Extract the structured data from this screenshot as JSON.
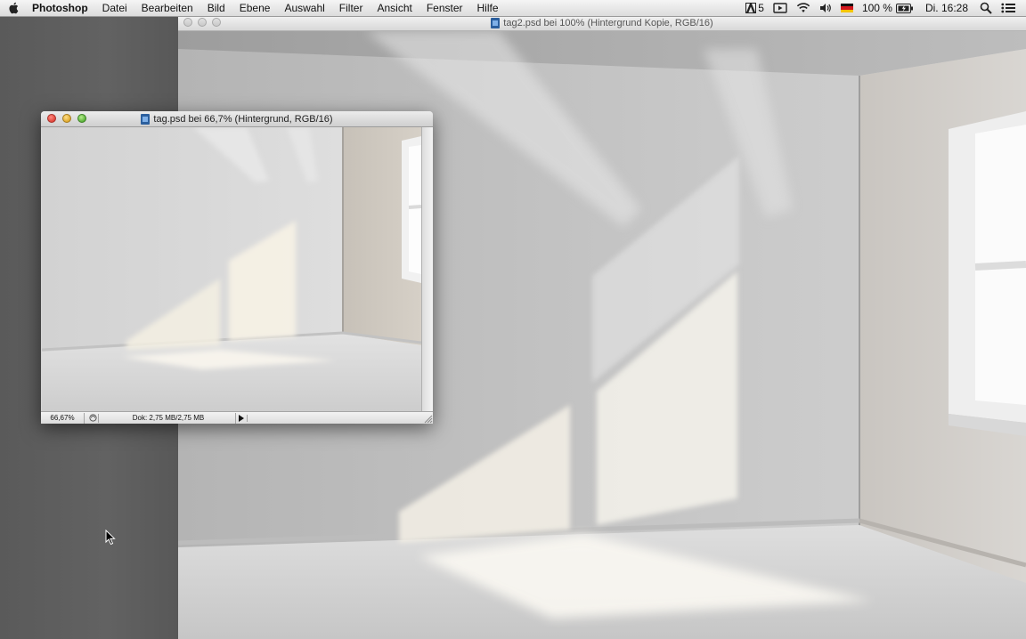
{
  "menubar": {
    "items": [
      "Photoshop",
      "Datei",
      "Bearbeiten",
      "Bild",
      "Ebene",
      "Auswahl",
      "Filter",
      "Ansicht",
      "Fenster",
      "Hilfe"
    ],
    "status": {
      "adobe_count": "5",
      "battery": "100 %",
      "clock": "Di. 16:28"
    }
  },
  "window_main": {
    "title": "tag2.psd bei 100% (Hintergrund Kopie, RGB/16)"
  },
  "window_small": {
    "title": "tag.psd bei 66,7% (Hintergrund, RGB/16)",
    "zoom": "66,67%",
    "doc_size": "Dok: 2,75 MB/2,75 MB"
  },
  "colors": {
    "desktop": "#5b5b5b",
    "menubar": "#e6e6e6",
    "traffic_red": "#e0443a",
    "traffic_yellow": "#e0a92d",
    "traffic_green": "#5ab23a"
  },
  "icons": [
    "apple-icon",
    "adobe-icon",
    "screen-record-icon",
    "wifi-icon",
    "volume-icon",
    "flag-de-icon",
    "battery-icon",
    "spotlight-search-icon",
    "notification-center-icon",
    "document-icon",
    "arrow-right-icon",
    "resize-grip-icon",
    "mouse-cursor-icon"
  ]
}
